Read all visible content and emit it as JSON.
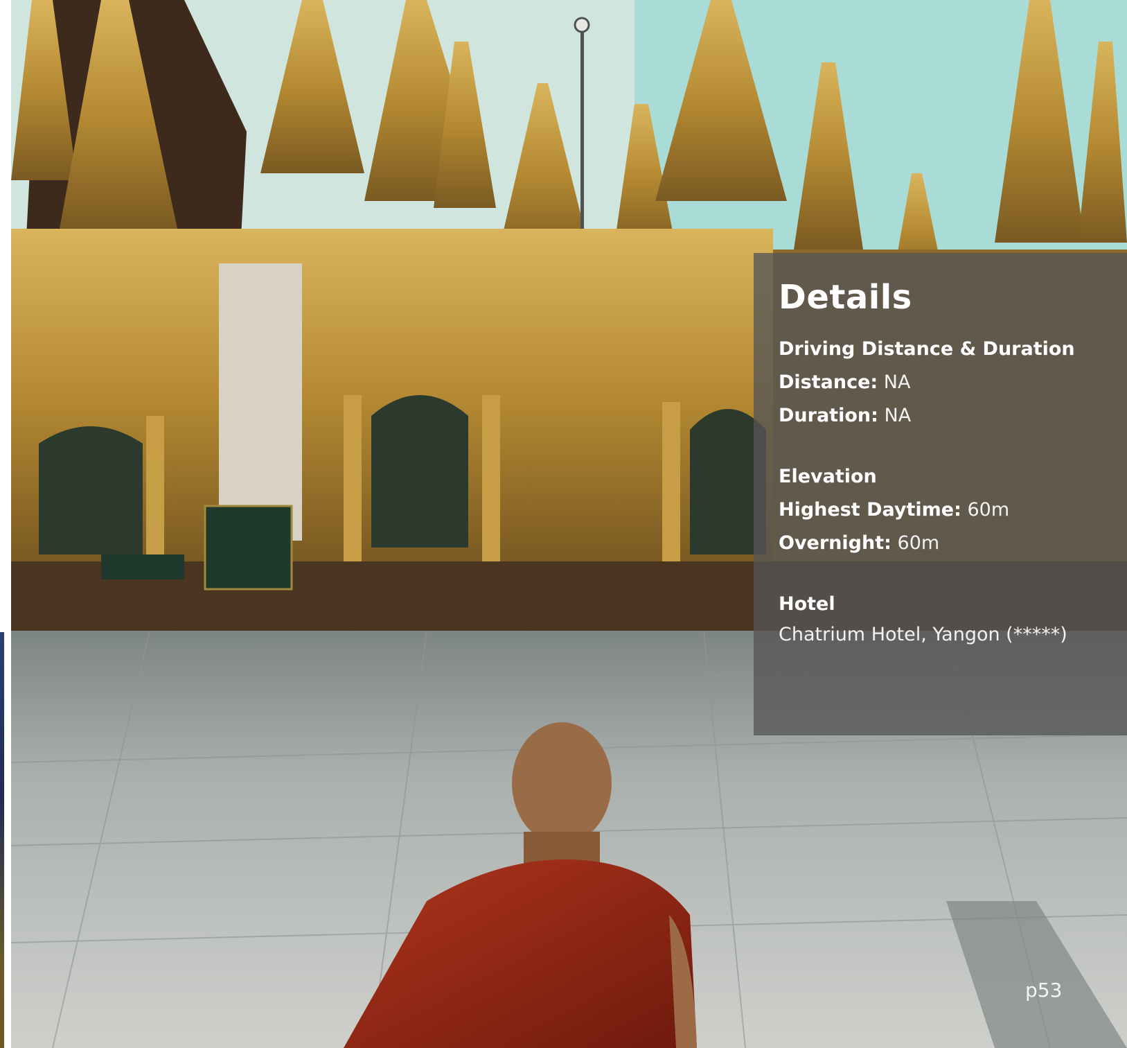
{
  "details": {
    "title": "Details",
    "driving": {
      "heading": "Driving Distance & Duration",
      "distance_label": "Distance:",
      "distance_value": "NA",
      "duration_label": "Duration:",
      "duration_value": "NA"
    },
    "elevation": {
      "heading": "Elevation",
      "daytime_label": "Highest Daytime:",
      "daytime_value": "60m",
      "overnight_label": "Overnight:",
      "overnight_value": "60m"
    },
    "hotel": {
      "heading": "Hotel",
      "name": "Chatrium Hotel, Yangon (*****)"
    }
  },
  "page_number": "p53"
}
